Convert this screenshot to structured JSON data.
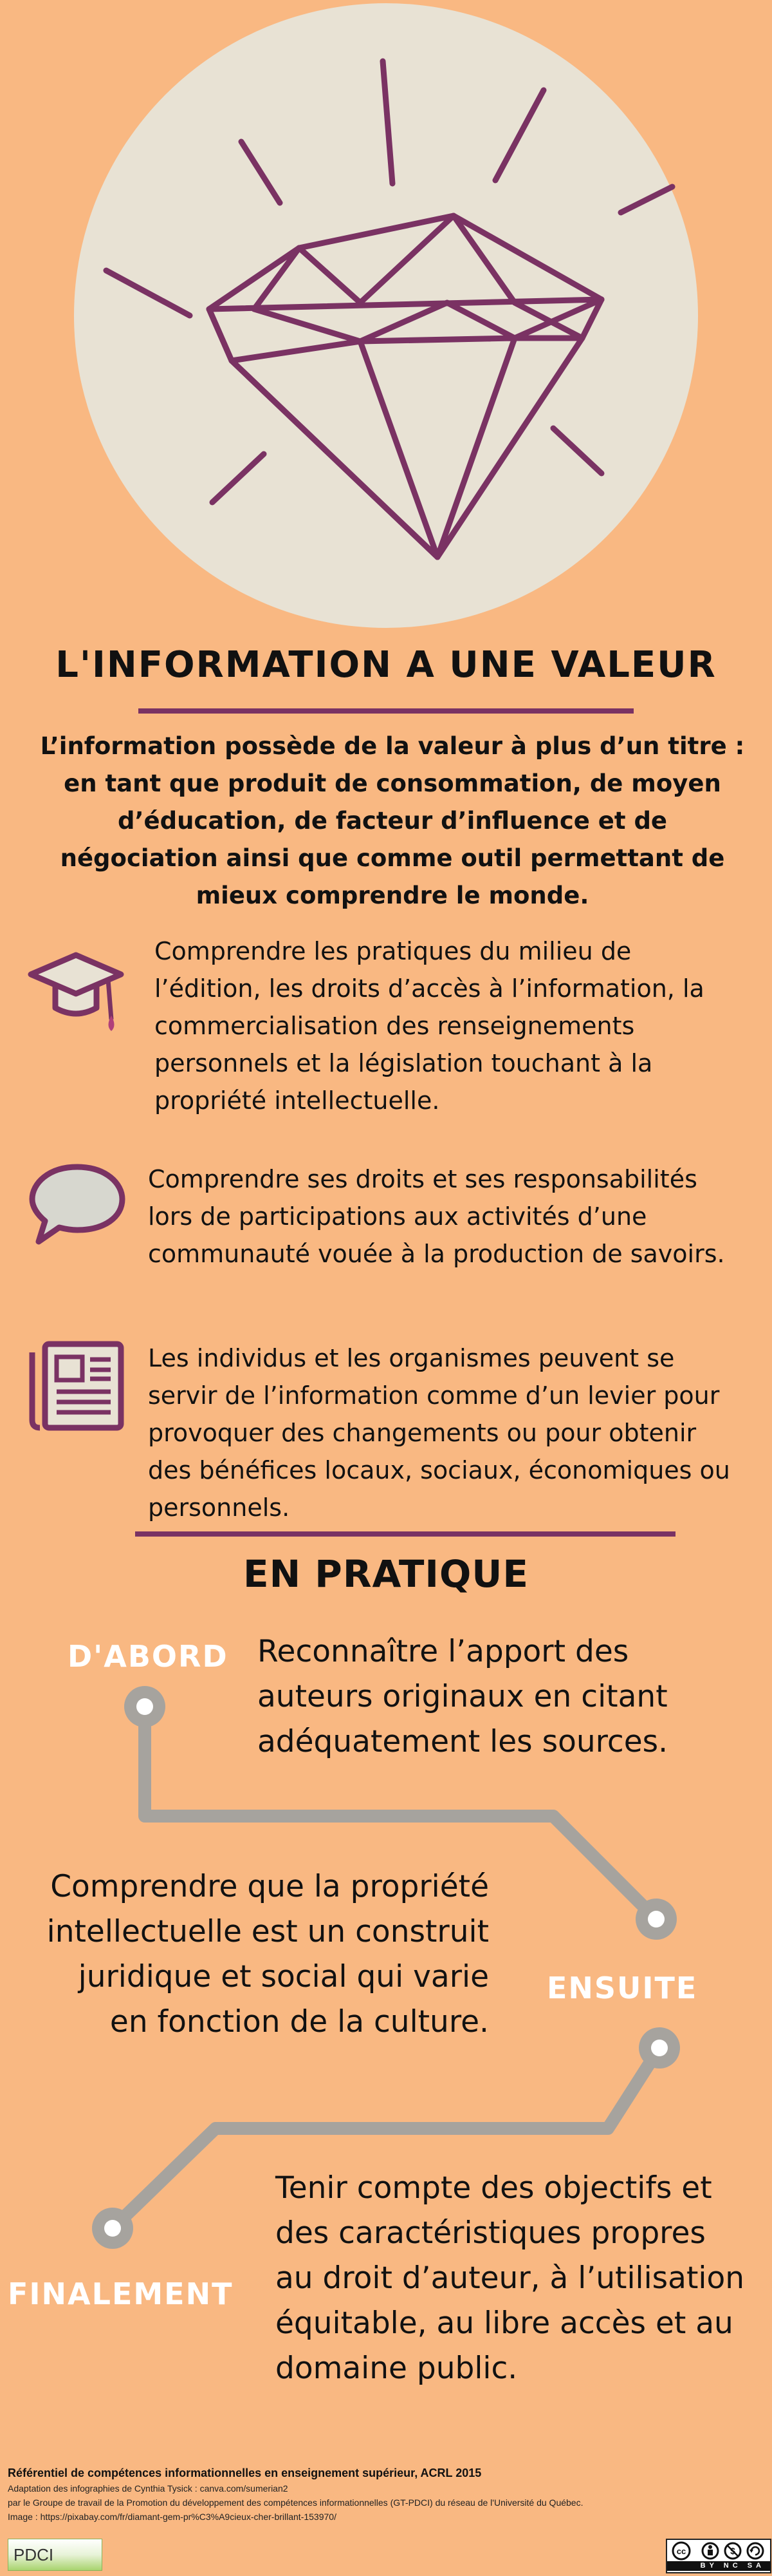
{
  "header": {
    "title": "L'INFORMATION A UNE VALEUR",
    "intro": "L’information possède de la valeur à plus d’un titre : en tant que produit de consommation, de moyen d’éducation, de facteur d’influence et de négociation ainsi que comme outil permettant de mieux comprendre le monde."
  },
  "items": [
    {
      "icon": "graduation-cap-icon",
      "text": "Comprendre les pratiques du milieu de l’édition, les droits d’accès à l’information, la commercialisation des renseignements personnels et la législation touchant à la propriété intellectuelle."
    },
    {
      "icon": "speech-bubble-icon",
      "text": "Comprendre ses droits et ses responsabilités lors de participations aux activités d’une communauté vouée à la production de savoirs."
    },
    {
      "icon": "newspaper-icon",
      "text": "Les individus et les organismes peuvent se servir de l’information comme d’un levier pour provoquer des changements ou pour obtenir des bénéfices locaux, sociaux, économiques ou personnels."
    }
  ],
  "practice": {
    "title": "EN PRATIQUE",
    "steps": [
      {
        "label": "D'ABORD",
        "text": "Reconnaître l’apport des auteurs originaux en citant adéquatement les sources."
      },
      {
        "label": "ENSUITE",
        "text": "Comprendre que la propriété intellectuelle est un construit juridique et social qui varie  en fonction de la culture."
      },
      {
        "label": "FINALEMENT",
        "text": "Tenir compte des objectifs et des caractéristiques propres au droit d’auteur, à l’utilisation équitable, au libre accès et au domaine public."
      }
    ]
  },
  "footer": {
    "reference": "Référentiel de compétences informationnelles en enseignement supérieur, ACRL 2015",
    "line1": "Adaptation des infographies de Cynthia Tysick : canva.com/sumerian2",
    "line2": "par le Groupe de travail de la Promotion du développement des compétences informationnelles (GT-PDCI) du réseau de l'Université du Québec.",
    "line3": "Image : https://pixabay.com/fr/diamant-gem-pr%C3%A9cieux-cher-brillant-153970/",
    "logo": "PDCI",
    "license": "BY NC SA"
  },
  "colors": {
    "background": "#F9B882",
    "accent": "#7A3263",
    "circle": "#E8E2D4",
    "timeline": "#A6A39E"
  }
}
